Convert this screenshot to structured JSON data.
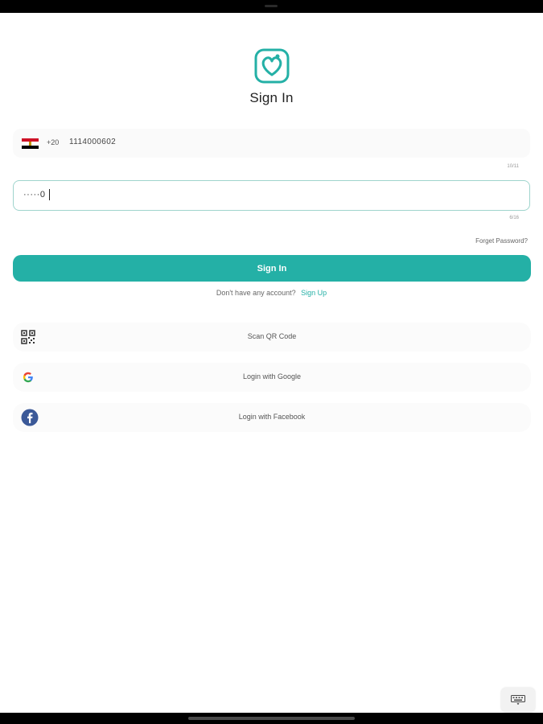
{
  "page": {
    "title": "Sign In"
  },
  "phone": {
    "dial_code": "+20",
    "value": "1114000602",
    "counter": "10/11"
  },
  "password": {
    "value": "·····0",
    "counter": "6/16"
  },
  "links": {
    "forget_password": "Forget Password?",
    "no_account": "Don't have any account?",
    "sign_up": "Sign Up"
  },
  "buttons": {
    "sign_in": "Sign In",
    "scan_qr": "Scan QR Code",
    "login_google": "Login with Google",
    "login_facebook": "Login with Facebook"
  },
  "colors": {
    "accent": "#24b0a6",
    "facebook": "#3b5998"
  },
  "icons": {
    "logo": "heart-stethoscope-logo",
    "flag": "egypt-flag",
    "qr": "qr-code-icon",
    "google": "google-icon",
    "facebook": "facebook-icon",
    "keyboard": "keyboard-icon"
  }
}
